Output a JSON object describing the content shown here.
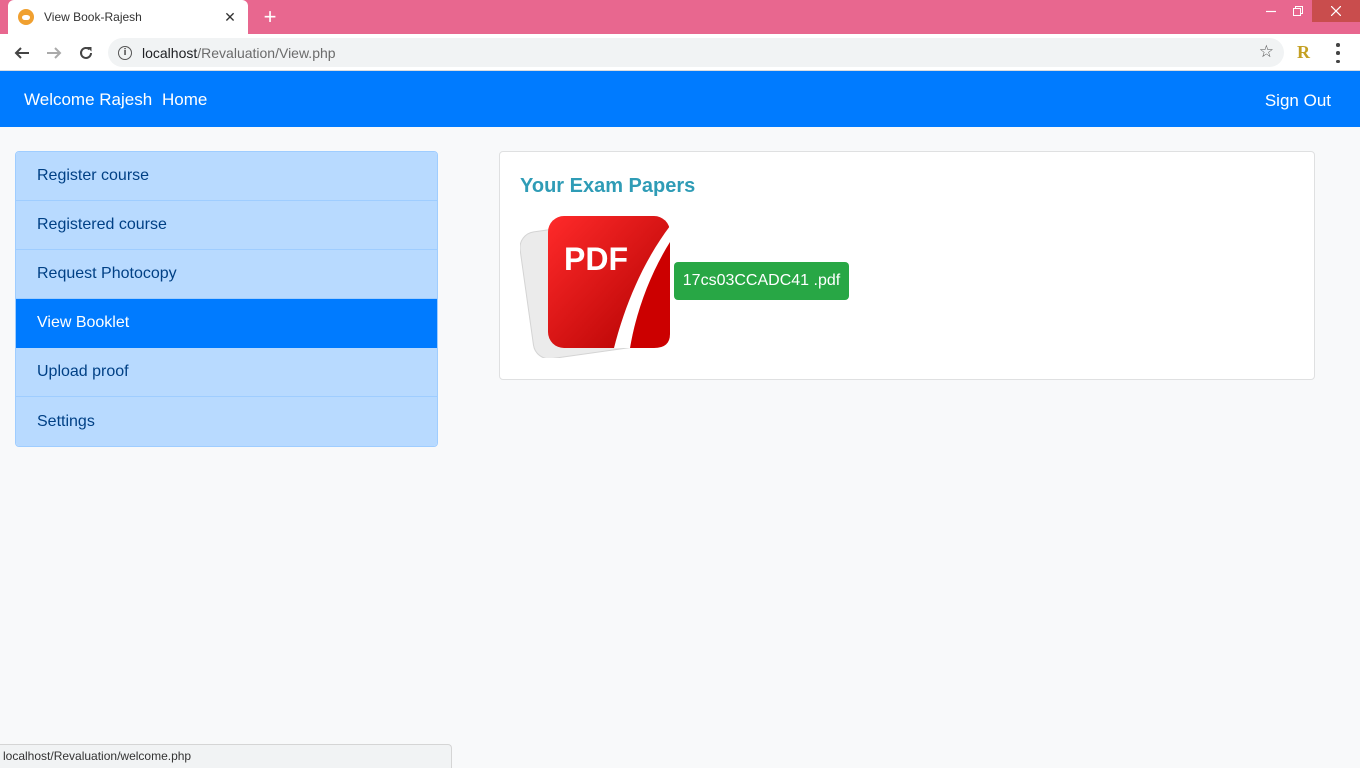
{
  "browser": {
    "tab_title": "View Book-Rajesh",
    "tab_close": "✕",
    "new_tab": "+",
    "url_host": "localhost",
    "url_path": "/Revaluation/View.php",
    "status_url": "localhost/Revaluation/welcome.php",
    "extension_letter": "R",
    "icons": [
      "back-arrow-icon",
      "forward-arrow-icon",
      "reload-icon",
      "info-icon",
      "star-icon",
      "kebab-menu-icon"
    ]
  },
  "navbar": {
    "brand": "Welcome Rajesh",
    "home": "Home",
    "sign_out": "Sign Out",
    "color": "#007bff"
  },
  "sidebar": {
    "items": [
      {
        "label": "Register course",
        "active": false
      },
      {
        "label": "Registered course",
        "active": false
      },
      {
        "label": "Request Photocopy",
        "active": false
      },
      {
        "label": "View Booklet",
        "active": true
      },
      {
        "label": "Upload proof",
        "active": false
      },
      {
        "label": "Settings",
        "active": false
      }
    ]
  },
  "main": {
    "title": "Your Exam Papers",
    "pdf_icon_text": "PDF",
    "file_label": "17cs03CCADC41 .pdf",
    "file_button_color": "#28a745",
    "title_color": "#2f9cb6"
  }
}
